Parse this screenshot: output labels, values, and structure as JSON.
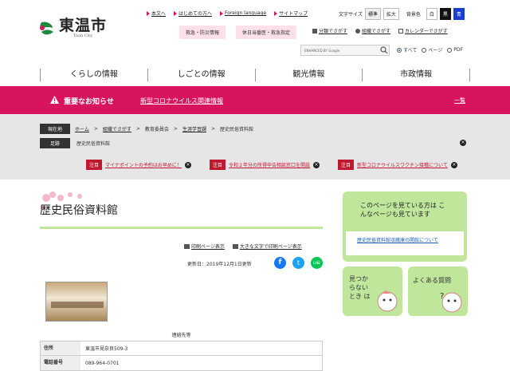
{
  "header": {
    "logo_text": "東温市",
    "logo_sub": "Toon City",
    "links": [
      {
        "label": "本文へ"
      },
      {
        "label": "はじめての方へ"
      },
      {
        "label": "Foreign language"
      },
      {
        "label": "サイトマップ"
      }
    ],
    "font_size_label": "文字サイズ",
    "font_std": "標準",
    "font_large": "拡大",
    "bg_color_label": "背景色",
    "bg_white": "白",
    "bg_black": "黒",
    "bg_blue": "青",
    "emergency_btn": "救急・防災情報",
    "holiday_btn": "休日当番医・救急指定",
    "category_link": "分類でさがす",
    "org_link": "組織でさがす",
    "calendar_link": "カレンダーでさがす",
    "search_placeholder": "ENHANCED BY Google",
    "radio_all": "すべて",
    "radio_page": "ページ",
    "radio_pdf": "PDF"
  },
  "nav": [
    "くらしの情報",
    "しごとの情報",
    "観光情報",
    "市政情報"
  ],
  "alert": {
    "title": "重要なお知らせ",
    "link": "新型コロナウイルス関連情報",
    "list": "一覧"
  },
  "breadcrumb": {
    "current_label": "現在地",
    "items": [
      "ホーム",
      "組織でさがす",
      "教育委員会",
      "生涯学習課",
      "歴史民俗資料館"
    ],
    "history_label": "足跡",
    "history_item": "歴史民俗資料館"
  },
  "notices": [
    {
      "tag": "注目",
      "text": "マイナポイントの予約はお早めに！"
    },
    {
      "tag": "注目",
      "text": "令和２年分の所得申告相談窓口を開設"
    },
    {
      "tag": "注目",
      "text": "新型コロナウイルスワクチン接種について"
    }
  ],
  "main": {
    "title": "歴史民俗資料館",
    "print_link": "印刷ページ表示",
    "large_print_link": "大きな文字で印刷ページ表示",
    "updated": "更新日：2019年12月1日更新",
    "contact_heading": "連絡先等",
    "table": [
      {
        "label": "住所",
        "value": "東温市見奈良509-3"
      },
      {
        "label": "電話番号",
        "value": "089-964-0701"
      }
    ]
  },
  "sidebar": {
    "related_heading": "このページを見ている方は こんなページも見ています",
    "related_link": "歴史民俗資料館収蔵庫の開館について",
    "notfound": "見つからない とき は",
    "faq": "よくある質問"
  },
  "colors": {
    "accent": "#d9145f",
    "green": "#bfe69b"
  }
}
